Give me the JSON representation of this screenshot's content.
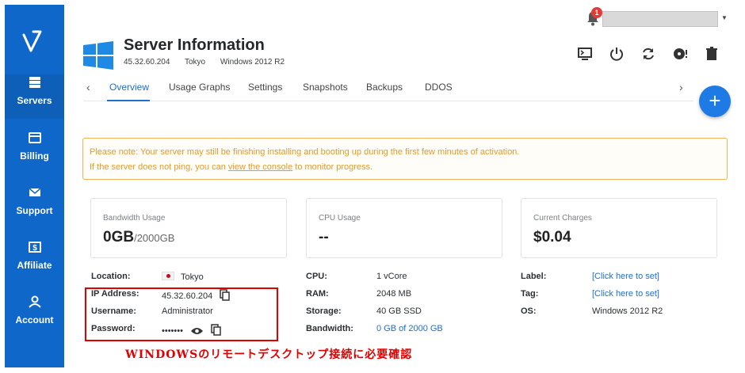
{
  "sidebar": {
    "items": [
      {
        "label": "Servers",
        "icon": "server-stack-icon"
      },
      {
        "label": "Billing",
        "icon": "credit-card-icon"
      },
      {
        "label": "Support",
        "icon": "envelope-icon"
      },
      {
        "label": "Affiliate",
        "icon": "dollar-icon"
      },
      {
        "label": "Account",
        "icon": "person-icon"
      }
    ],
    "brand_color": "#0f68c9"
  },
  "topbar": {
    "notification_count": "1"
  },
  "header": {
    "title": "Server Information",
    "ip": "45.32.60.204",
    "location": "Tokyo",
    "os": "Windows 2012 R2"
  },
  "actions": [
    "console-icon",
    "power-icon",
    "restart-icon",
    "reinstall-icon",
    "trash-icon"
  ],
  "tabs": [
    {
      "label": "Overview",
      "active": true
    },
    {
      "label": "Usage Graphs"
    },
    {
      "label": "Settings"
    },
    {
      "label": "Snapshots"
    },
    {
      "label": "Backups"
    },
    {
      "label": "DDOS"
    }
  ],
  "fab_label": "+",
  "notice": {
    "line1": "Please note: Your server may still be finishing installing and booting up during the first few minutes of activation.",
    "line2_before": "If the server does not ping, you can ",
    "line2_link": "view the console",
    "line2_after": " to monitor progress."
  },
  "cards": [
    {
      "label": "Bandwidth Usage",
      "value": "0GB",
      "unit": "/2000GB"
    },
    {
      "label": "CPU Usage",
      "value": "--"
    },
    {
      "label": "Current Charges",
      "value": "$0.04"
    }
  ],
  "details": {
    "col1": [
      {
        "key": "Location:",
        "value": "Tokyo"
      },
      {
        "key": "IP Address:",
        "value": "45.32.60.204"
      },
      {
        "key": "Username:",
        "value": "Administrator"
      },
      {
        "key": "Password:",
        "value": "•••••••"
      }
    ],
    "col2": [
      {
        "key": "CPU:",
        "value": "1 vCore"
      },
      {
        "key": "RAM:",
        "value": "2048 MB"
      },
      {
        "key": "Storage:",
        "value": "40 GB SSD"
      },
      {
        "key": "Bandwidth:",
        "value": "0 GB of 2000 GB"
      }
    ],
    "col3": [
      {
        "key": "Label:",
        "value": "[Click here to set]"
      },
      {
        "key": "Tag:",
        "value": "[Click here to set]"
      },
      {
        "key": "OS:",
        "value": "Windows 2012 R2"
      }
    ]
  },
  "annotation": "WINDOWSのリモートデスクトップ接続に必要確認"
}
